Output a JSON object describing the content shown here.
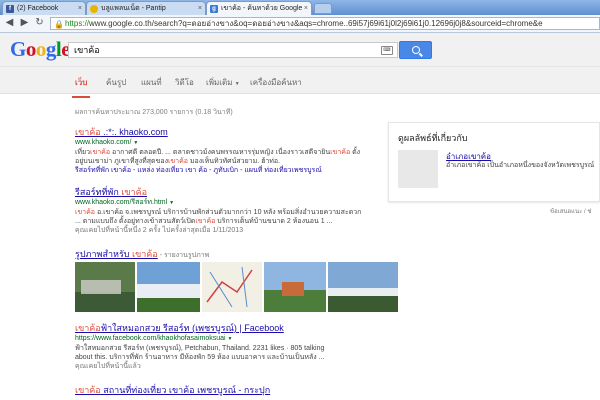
{
  "browser": {
    "tabs": [
      {
        "label": "(2) Facebook",
        "icon": "facebook-icon"
      },
      {
        "label": "บลูแพลนเน็ต - Pantip",
        "icon": "pantip-icon"
      },
      {
        "label": "เขาค้อ - ค้นหาด้วย Google",
        "icon": "google-icon"
      }
    ],
    "url_scheme": "https://",
    "url_rest": "www.google.co.th/search?q=ดอยอ่างขาง&oq=ดอยอ่างขาง&aqs=chrome..69i57j69i61j0l2j69i61j0.12696j0j8&sourceid=chrome&e"
  },
  "google": {
    "logo": "Google",
    "query": "เขาค้อ",
    "tabs": [
      "เว็บ",
      "ค้นรูป",
      "แผนที่",
      "วิดีโอ",
      "เพิ่มเติม",
      "เครื่องมือค้นหา"
    ],
    "stats": "ผลการค้นหาประมาณ 273,000 รายการ (0.18 วินาที)"
  },
  "results": [
    {
      "title_pre": "",
      "title_hl": "เขาค้อ",
      "title_post": " .:*:. khaoko.com",
      "url": "www.khaoko.com/",
      "snippet1_pre": "เที่ยว",
      "snippet1_hl": "เขาค้อ",
      "snippet1_post": " อากาศดี ตลอดปี. ... ตลาดชาวม้งคนพรรณหารรุ่มหญิง เนื่องราวเสดีจายิน",
      "snippet1_hl2": "เขาค้อ",
      "snippet1_end": " ตั้ง",
      "snippet2_pre": "อยู่บนเขาม่า ภูเขาที่สูงที่สุดของ",
      "snippet2_hl": "เขาค้อ",
      "snippet2_post": " มองเห็นทิวทัศน์สวยาม. ฮ้าท่อ.",
      "sublinks": "รีสอร์ทที่พัก เขาค้อ - แหล่ง ท่องเที่ยว เขา ค้อ - ภูทับเบิก - แผนที่ ท่องเที่ยวเพชรบูรณ์"
    },
    {
      "title_pre": "รีสอร์ทที่พัก ",
      "title_hl": "เขาค้อ",
      "title_post": "",
      "url": "www.khaoko.com/รีสอร์ท.html",
      "snippet1_pre": "",
      "snippet1_hl": "เขาค้อ",
      "snippet1_post": " อ.เขาค้อ จ.เพชรบูรณ์ บริการบ้านพักส่วนตัวมากกว่า 10 หลัง พร้อมสิ่งอำนวยความสะดวก",
      "snippet1_hl2": "",
      "snippet1_end": "",
      "snippet2_pre": "... ตามแบบถึง ตั้งอยู่ทางเข้าสวนสัตว์เปิด",
      "snippet2_hl": "เขาค้อ",
      "snippet2_post": " บริการเต็นท์บ้านขนาด 2 ห้องนอน 1 ...",
      "sublinks": "",
      "visited": "คุณเคยไปที่หน้านี้หนึ่ง 2 ครั้ง ไปครั้งล่าสุดเมื่อ 1/11/2013"
    },
    {
      "title_pre": "รูปภาพสำหรับ ",
      "title_hl": "เขาค้อ",
      "title_post": "",
      "report": " - รายงานรูปภาพ"
    },
    {
      "title_pre": "",
      "title_hl": "เขาค้อ",
      "title_post": "ฟ้าใสหมอกสวย รีสอร์ท (เพชรบูรณ์) | Facebook",
      "url": "https://www.facebook.com/khaokhofasaimoksuai",
      "snippet1_pre": "เขาค้อ",
      "snippet1_hl": "",
      "snippet1_post": "ฟ้าใสหมอกสวย รีสอร์ท (เพชรบูรณ์), Petchabun, Thailand. 2231 likes · 805 talking",
      "snippet1_hl2": "",
      "snippet1_end": "",
      "snippet2_pre": "about this. บริการที่พัก ร้านอาหาร มีห้องพัก 59 ห้อง แบบอาคาร และบ้านเป็นหลัง ...",
      "snippet2_hl": "",
      "snippet2_post": "",
      "sublinks": "",
      "visited": "คุณเคยไปที่หน้านี้แล้ว"
    },
    {
      "title_pre": "",
      "title_hl": "เขาค้อ",
      "title_post": " สถานที่ท่องเที่ยว เขาค้อ เพชรบูรณ์ - กระปุก"
    }
  ],
  "knowledge": {
    "title": "ดูผลลัพธ์ที่เกี่ยวกับ",
    "name": "อำเภอเขาค้อ",
    "desc": "อำเภอเขาค้อ เป็นอำเภอหนึ่งของจังหวัดเพชรบูรณ์",
    "feedback": "ข้อเสนอแนะ / ช่"
  },
  "colors": {
    "link": "#1a0dab",
    "url": "#006621",
    "highlight": "#dd4b39",
    "search_button": "#4a88e7"
  }
}
